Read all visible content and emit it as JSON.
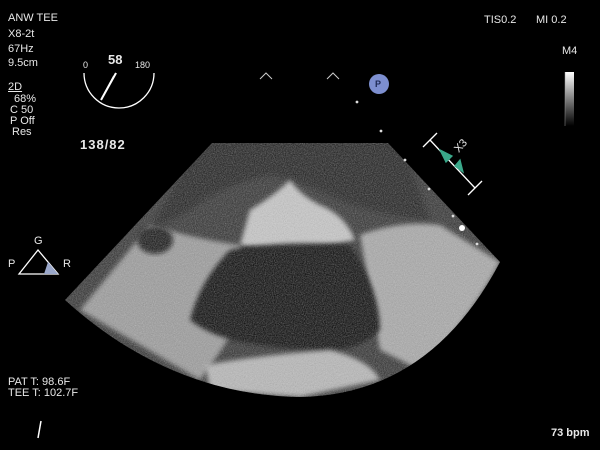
{
  "header": {
    "line1": "ANW TEE",
    "line2": "X8-2t",
    "line3": "67Hz",
    "line4": "9.5cm"
  },
  "indices": {
    "tis": "TIS0.2",
    "mi": "MI 0.2"
  },
  "angle": {
    "min": "0",
    "value": "58",
    "max": "180"
  },
  "mode": {
    "label": "2D",
    "gain": "68%",
    "compression": "C 50",
    "power": "P Off",
    "resolution": "Res"
  },
  "blood_pressure": "138/82",
  "grayscale_map": "M4",
  "depth_marker": "X3",
  "probe_marker": "P",
  "orientation": {
    "top": "G",
    "left": "P",
    "right": "R"
  },
  "temperatures": {
    "patient": "PAT T: 98.6F",
    "probe": "TEE T: 102.7F"
  },
  "heart_rate": "73 bpm",
  "colors": {
    "background": "#000000",
    "text": "#e8e8e8",
    "marker_green": "#3aa88a",
    "probe_badge": "#7d8fd0"
  }
}
